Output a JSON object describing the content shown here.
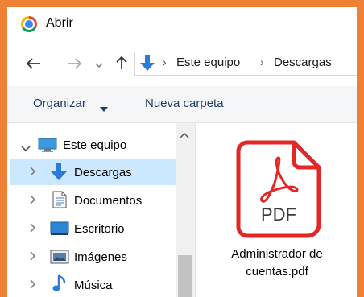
{
  "window": {
    "title": "Abrir"
  },
  "address": {
    "crumbs": [
      "Este equipo",
      "Descargas"
    ],
    "separator": "›"
  },
  "toolbar": {
    "organize_label": "Organizar",
    "new_folder_label": "Nueva carpeta"
  },
  "sidebar": {
    "root": {
      "label": "Este equipo",
      "icon": "computer-icon"
    },
    "items": [
      {
        "label": "Descargas",
        "icon": "download-arrow-icon",
        "selected": true
      },
      {
        "label": "Documentos",
        "icon": "document-icon"
      },
      {
        "label": "Escritorio",
        "icon": "desktop-icon"
      },
      {
        "label": "Imágenes",
        "icon": "image-icon"
      },
      {
        "label": "Música",
        "icon": "music-icon"
      }
    ]
  },
  "files": [
    {
      "name": "Administrador de\ncuentas.pdf",
      "type_label": "PDF",
      "icon": "pdf-file-icon"
    }
  ],
  "colors": {
    "frame": "#ee8136",
    "selection": "#cce8ff",
    "accent_blue": "#2b7bd8",
    "pdf_red": "#e32726"
  }
}
